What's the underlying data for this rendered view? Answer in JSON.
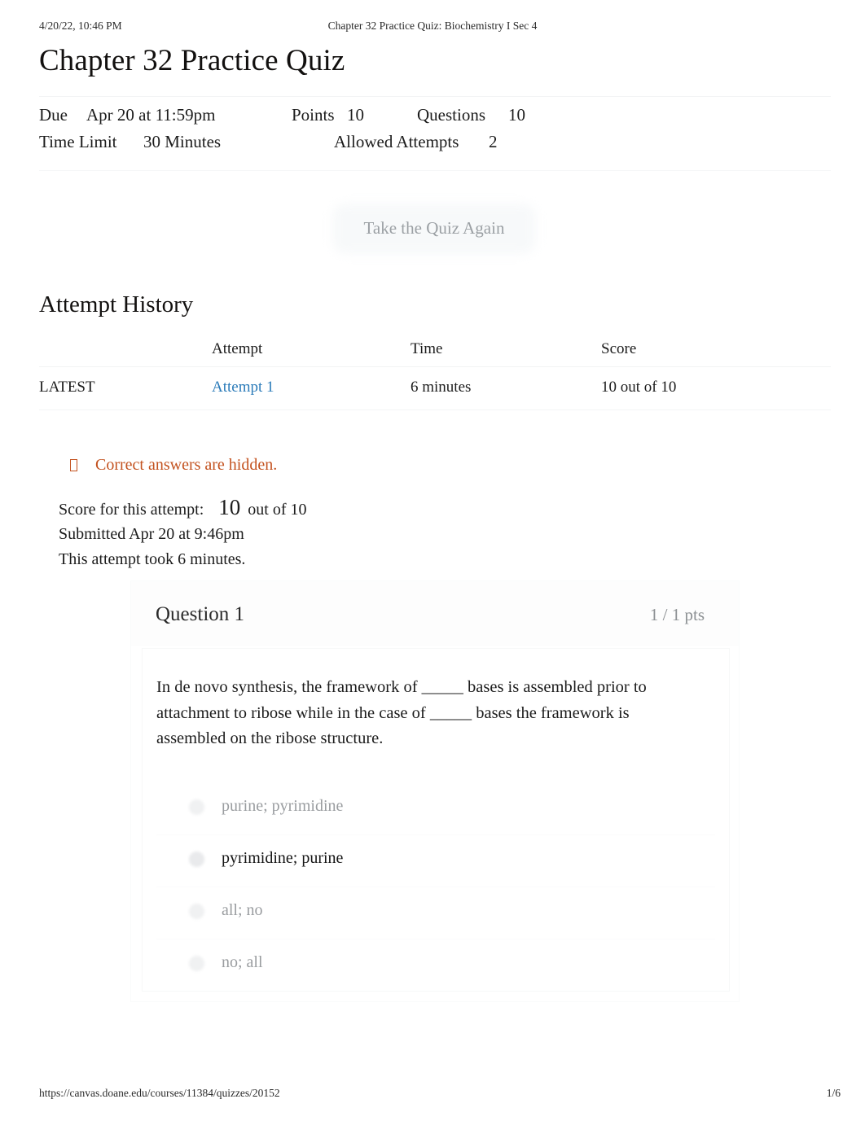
{
  "print_header": {
    "timestamp": "4/20/22, 10:46 PM",
    "document_title": "Chapter 32 Practice Quiz: Biochemistry I Sec 4"
  },
  "page_title": "Chapter 32 Practice Quiz",
  "quiz_meta": {
    "due_label": "Due",
    "due_value": "Apr 20 at 11:59pm",
    "points_label": "Points",
    "points_value": "10",
    "questions_label": "Questions",
    "questions_value": "10",
    "time_limit_label": "Time Limit",
    "time_limit_value": "30 Minutes",
    "allowed_attempts_label": "Allowed Attempts",
    "allowed_attempts_value": "2"
  },
  "retake_button": {
    "label": "Take the Quiz Again"
  },
  "attempt_history": {
    "heading": "Attempt History",
    "columns": {
      "kept": "",
      "attempt": "Attempt",
      "time": "Time",
      "score": "Score"
    },
    "rows": [
      {
        "kept": "LATEST",
        "attempt": "Attempt 1",
        "time": "6 minutes",
        "score": "10 out of 10"
      }
    ]
  },
  "hidden_notice": {
    "icon": "warning-box-icon",
    "text": "Correct answers are hidden.",
    "color": "#c3521f"
  },
  "score_summary": {
    "score_label": "Score for this attempt:",
    "score_value": "10",
    "score_suffix": "out of 10",
    "submitted": "Submitted Apr 20 at 9:46pm",
    "duration": "This attempt took 6 minutes."
  },
  "question": {
    "name": "Question 1",
    "points": "1 / 1 pts",
    "text": "In de novo synthesis, the framework of _____ bases is assembled prior to attachment to ribose while in the case of _____ bases the framework is assembled on the ribose structure.",
    "answers": [
      {
        "label": "purine; pyrimidine",
        "selected": false
      },
      {
        "label": "pyrimidine; purine",
        "selected": true
      },
      {
        "label": "all; no",
        "selected": false
      },
      {
        "label": "no; all",
        "selected": false
      }
    ]
  },
  "print_footer": {
    "url": "https://canvas.doane.edu/courses/11384/quizzes/20152",
    "page": "1/6"
  },
  "colors": {
    "link": "#2b7bb9",
    "notice": "#c3521f",
    "muted": "#9a9da0"
  }
}
